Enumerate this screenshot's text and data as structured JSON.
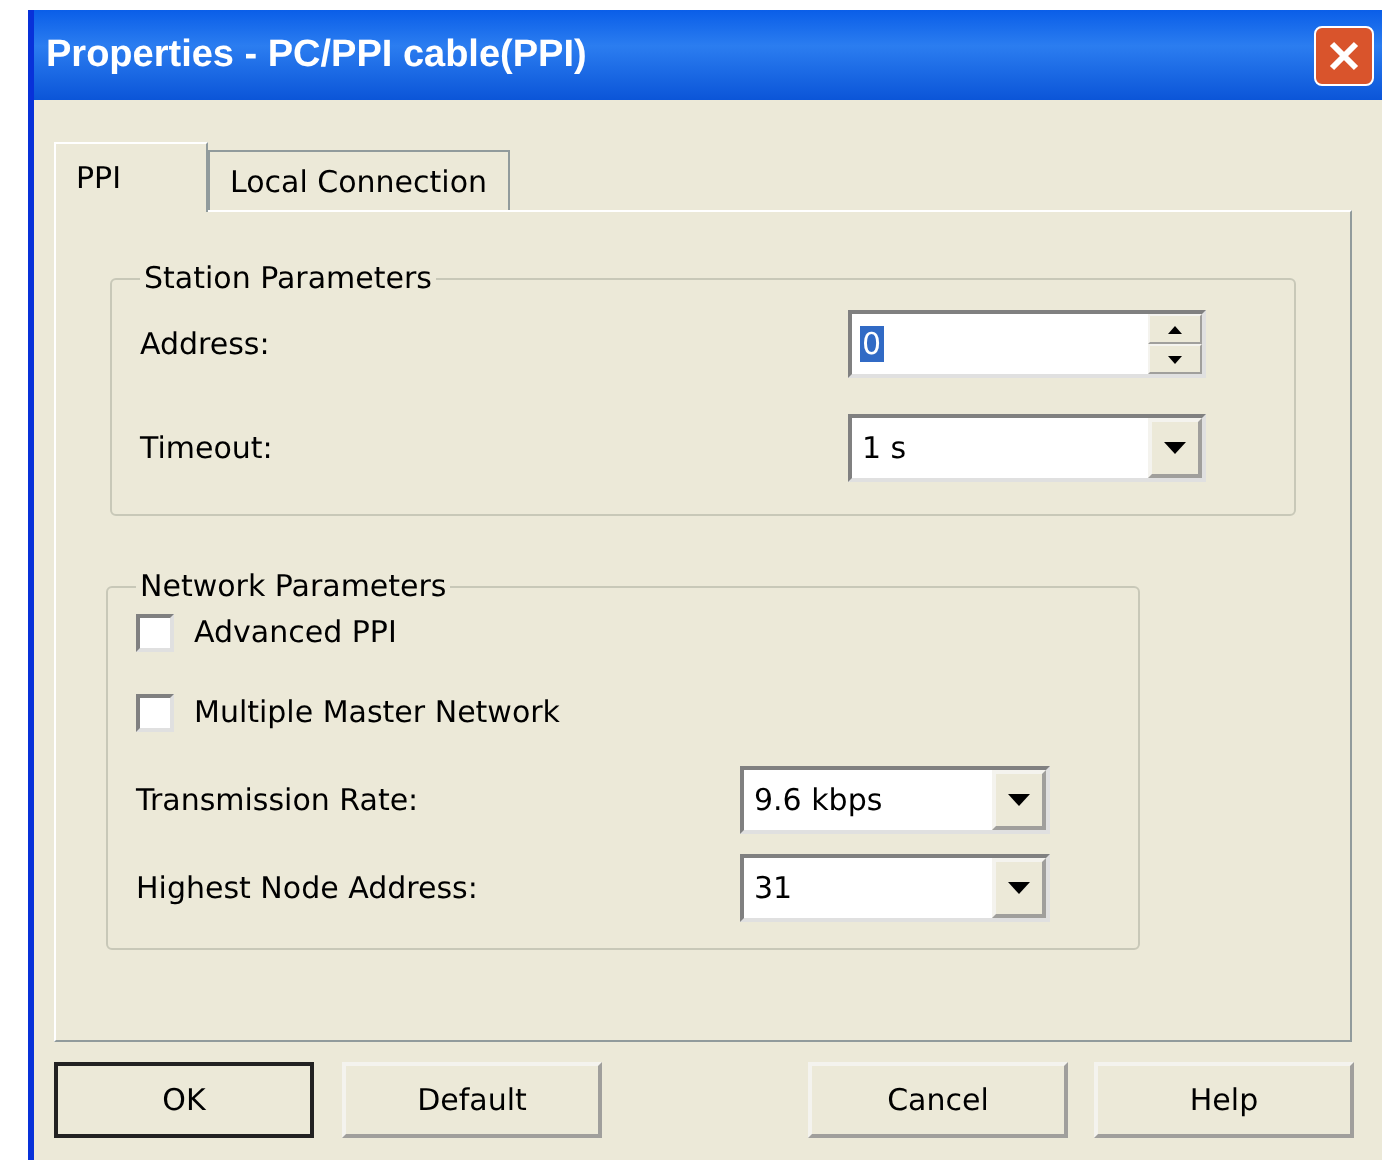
{
  "window": {
    "title": "Properties - PC/PPI cable(PPI)"
  },
  "tabs": [
    {
      "label": "PPI",
      "selected": true
    },
    {
      "label": "Local Connection",
      "selected": false
    }
  ],
  "station_parameters": {
    "title": "Station Parameters",
    "fields": [
      {
        "kind": "spinner",
        "label": "Address:",
        "value": "0",
        "text_selected": true
      },
      {
        "kind": "dropdown",
        "label": "Timeout:",
        "value": "1 s",
        "text_selected": false
      }
    ]
  },
  "network_parameters": {
    "title": "Network Parameters",
    "checkboxes": [
      {
        "label": "Advanced PPI",
        "checked": false
      },
      {
        "label": "Multiple Master Network",
        "checked": false
      }
    ],
    "fields": [
      {
        "kind": "dropdown",
        "label": "Transmission Rate:",
        "value": "9.6 kbps",
        "text_selected": false
      },
      {
        "kind": "dropdown",
        "label": "Highest Node Address:",
        "value": "31",
        "text_selected": false
      }
    ]
  },
  "buttons": [
    {
      "label": "OK",
      "default": true
    },
    {
      "label": "Default",
      "default": false
    },
    {
      "label": "Cancel",
      "default": false
    },
    {
      "label": "Help",
      "default": false
    }
  ]
}
